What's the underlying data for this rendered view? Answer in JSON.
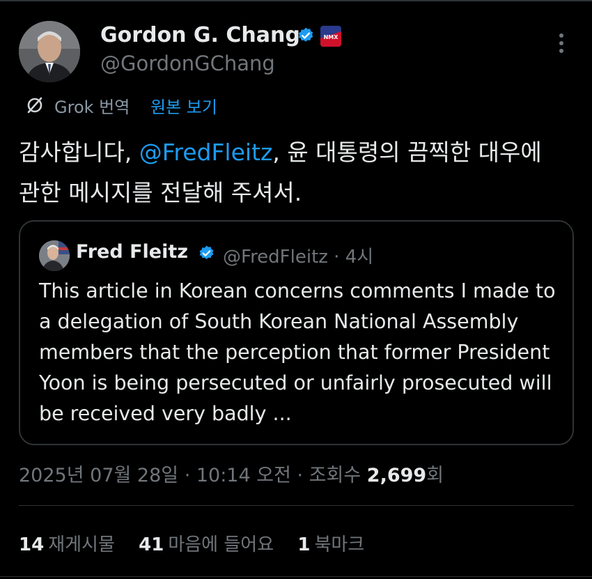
{
  "author": {
    "display_name": "Gordon G. Chang",
    "handle": "@GordonGChang",
    "verified_color": "#1d9bf0",
    "avatar": "avatar-photo",
    "affiliation_badge": "newsmax-badge",
    "affiliation_badge_text": "NMX"
  },
  "translation": {
    "label": "Grok 번역",
    "show_original": "원본 보기"
  },
  "tweet": {
    "text_before": "감사합니다, ",
    "mention": "@FredFleitz",
    "text_after": ", 윤 대통령의 끔찍한 대우에 관한 메시지를 전달해 주셔서."
  },
  "quote": {
    "display_name": "Fred Fleitz",
    "handle_time": "@FredFleitz · 4시",
    "text": "This article in Korean concerns comments I made to a delegation of South Korean National Assembly members that the perception that former President Yoon is being persecuted or unfairly prosecuted will be received very badly ..."
  },
  "meta": {
    "datetime": "2025년 07월 28일 · 10:14 오전 · 조회수 ",
    "views": "2,699",
    "views_suffix": "회"
  },
  "stats": {
    "reposts_count": "14",
    "reposts_label": "재게시물",
    "likes_count": "41",
    "likes_label": "마음에 들어요",
    "bookmarks_count": "1",
    "bookmarks_label": "북마크"
  },
  "colors": {
    "background": "#000000",
    "text": "#e7e9ea",
    "secondary": "#71767b",
    "accent": "#1d9bf0",
    "border": "#2f3336"
  }
}
